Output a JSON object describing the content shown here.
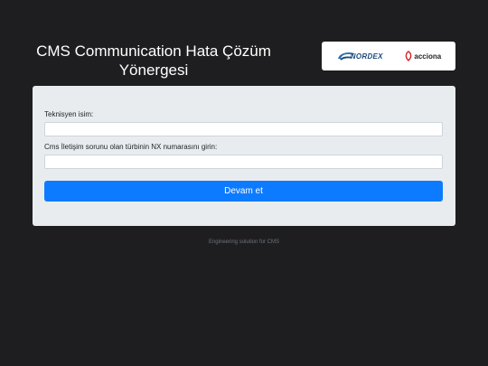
{
  "header": {
    "title": "CMS Communication Hata Çözüm Yönergesi"
  },
  "logos": {
    "nordex_text": "NORDEX",
    "acciona_text": "acciona"
  },
  "form": {
    "technician_label": "Teknisyen isim:",
    "technician_value": "",
    "turbine_label": "Cms İletişim sorunu olan türbinin NX numarasını girin:",
    "turbine_value": "",
    "submit_label": "Devam et"
  },
  "footer": {
    "text": "Engineering solution for CMS"
  },
  "colors": {
    "background": "#1e1e20",
    "card": "#e9ecef",
    "primary_button": "#0d7bff"
  }
}
